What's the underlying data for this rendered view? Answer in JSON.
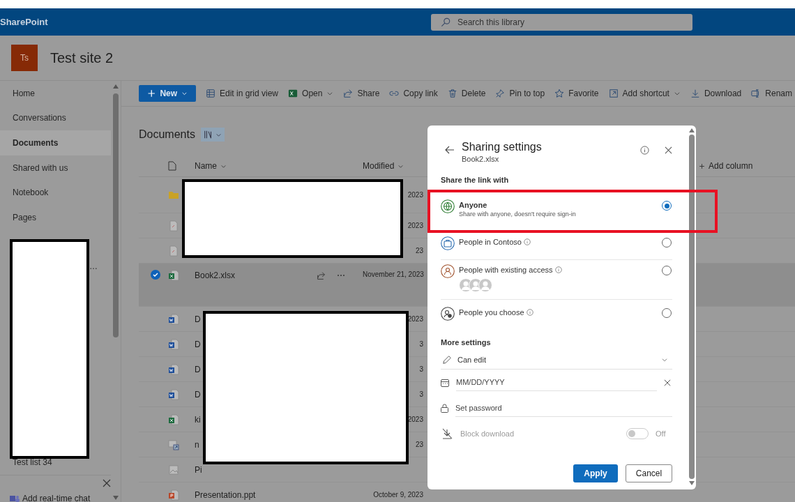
{
  "suite_bar": {
    "app_name": "SharePoint",
    "search": {
      "placeholder": "Search this library"
    }
  },
  "site": {
    "logo": "Ts",
    "title": "Test site 2"
  },
  "nav": {
    "items": [
      {
        "label": "Home",
        "selected": false
      },
      {
        "label": "Conversations",
        "selected": false
      },
      {
        "label": "Documents",
        "selected": true
      },
      {
        "label": "Shared with us",
        "selected": false
      },
      {
        "label": "Notebook",
        "selected": false
      },
      {
        "label": "Pages",
        "selected": false
      }
    ],
    "lower_items": [
      {
        "label": "…",
        "kind": "clipped"
      },
      {
        "label": "Test list 34",
        "kind": "link"
      }
    ],
    "chat": "Add real-time chat"
  },
  "commands": [
    {
      "label": "New",
      "kind": "new",
      "dropdown": true
    },
    {
      "label": "Edit in grid view",
      "kind": "grid",
      "dropdown": false
    },
    {
      "label": "Open",
      "kind": "excel",
      "dropdown": true
    },
    {
      "label": "Share",
      "kind": "share",
      "dropdown": false
    },
    {
      "label": "Copy link",
      "kind": "link",
      "dropdown": false
    },
    {
      "label": "Delete",
      "kind": "trash",
      "dropdown": false
    },
    {
      "label": "Pin to top",
      "kind": "pin",
      "dropdown": false
    },
    {
      "label": "Favorite",
      "kind": "star",
      "dropdown": false
    },
    {
      "label": "Add shortcut",
      "kind": "shortcut",
      "dropdown": true
    },
    {
      "label": "Download",
      "kind": "download",
      "dropdown": false
    },
    {
      "label": "Renam",
      "kind": "rename",
      "dropdown": false
    }
  ],
  "library": {
    "title": "Documents",
    "columns": [
      {
        "label": "Name"
      },
      {
        "label": "Modified"
      }
    ],
    "add_column": "Add column",
    "rows": [
      {
        "kind": "folder",
        "modified": "2023",
        "selected": false
      },
      {
        "kind": "page",
        "modified": "2023",
        "selected": false
      },
      {
        "kind": "page",
        "modified": "23",
        "selected": false
      },
      {
        "kind": "excel",
        "name": "Book2.xlsx",
        "modified": "November 21, 2023",
        "selected": true
      },
      {
        "kind": "word",
        "name": "D",
        "modified": "2023",
        "selected": false
      },
      {
        "kind": "word",
        "name": "D",
        "modified": "3",
        "selected": false
      },
      {
        "kind": "word",
        "name": "D",
        "modified": "3",
        "selected": false
      },
      {
        "kind": "word",
        "name": "D",
        "modified": "3",
        "selected": false
      },
      {
        "kind": "excel",
        "name": "ki",
        "modified": "2023",
        "selected": false
      },
      {
        "kind": "link",
        "name": "n",
        "modified": "23",
        "selected": false
      },
      {
        "kind": "image",
        "name": "Pi",
        "selected": false
      },
      {
        "kind": "ppt",
        "name": "Presentation.ppt",
        "modified": "October 9, 2023",
        "selected": false
      }
    ]
  },
  "sharing_dialog": {
    "title": "Sharing settings",
    "file": "Book2.xlsx",
    "section": "Share the link with",
    "options": [
      {
        "kind": "globe",
        "label": "Anyone",
        "description": "Share with anyone, doesn't require sign-in",
        "info": false,
        "selected": true
      },
      {
        "kind": "org",
        "label": "People in Contoso",
        "info": true,
        "selected": false
      },
      {
        "kind": "existing",
        "label": "People with existing access",
        "info": true,
        "selected": false
      },
      {
        "kind": "choose",
        "label": "People you choose",
        "info": true,
        "selected": false
      }
    ],
    "more_settings": "More settings",
    "permission": "Can edit",
    "expiry": {
      "placeholder": "MM/DD/YYYY"
    },
    "password": {
      "placeholder": "Set password"
    },
    "block_download": {
      "label": "Block download",
      "on": false,
      "state": "Off",
      "disabled": true
    },
    "apply": "Apply",
    "cancel": "Cancel"
  }
}
